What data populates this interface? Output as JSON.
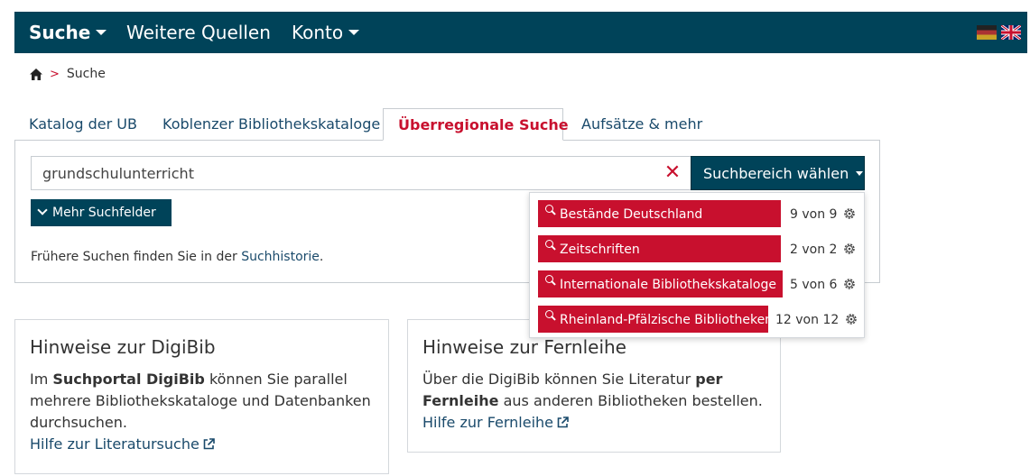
{
  "nav": {
    "search_label": "Suche",
    "sources_label": "Weitere Quellen",
    "account_label": "Konto",
    "bg_color": "#004359",
    "languages": [
      "german-flag-icon",
      "uk-flag-icon"
    ]
  },
  "breadcrumb": {
    "separator": ">",
    "current": "Suche"
  },
  "tabs": [
    {
      "label": "Katalog der UB"
    },
    {
      "label": "Koblenzer Bibliothekskataloge"
    },
    {
      "label": "Überregionale Suche"
    },
    {
      "label": "Aufsätze & mehr"
    }
  ],
  "active_tab_index": 2,
  "search": {
    "value": "grundschulunterricht",
    "clear_symbol": "✕",
    "scope_button": "Suchbereich wählen",
    "more_fields": "Mehr Suchfelder",
    "history_prefix": "Frühere Suchen finden Sie in der",
    "history_link": "Suchhistorie",
    "history_suffix": "."
  },
  "dropdown": {
    "items": [
      {
        "label": "Bestände Deutschland",
        "selected": 9,
        "total": 9,
        "count_text": "9 von 9"
      },
      {
        "label": "Zeitschriften",
        "selected": 2,
        "total": 2,
        "count_text": "2 von 2"
      },
      {
        "label": "Internationale Bibliothekskataloge",
        "selected": 5,
        "total": 6,
        "count_text": "5 von 6"
      },
      {
        "label": "Rheinland-Pfälzische Bibliotheken",
        "selected": 12,
        "total": 12,
        "count_text": "12 von 12"
      }
    ]
  },
  "boxes": {
    "digibib": {
      "title": "Hinweise zur DigiBib",
      "text_1": "Im ",
      "bold": "Suchportal DigiBib",
      "text_2": " können Sie parallel mehrere Bibliothekskataloge und Datenbanken durchsuchen.",
      "link": "Hilfe zur Literatursuche"
    },
    "fernleihe": {
      "title": "Hinweise zur Fernleihe",
      "text_1": "Über die DigiBib können Sie Literatur ",
      "bold": "per Fernleihe",
      "text_2": " aus anderen Bibliotheken bestellen.",
      "link": "Hilfe zur Fernleihe"
    }
  },
  "colors": {
    "primary": "#004359",
    "accent_red": "#c8102e",
    "link": "#1a4a6b",
    "border": "#c7ccd1"
  }
}
